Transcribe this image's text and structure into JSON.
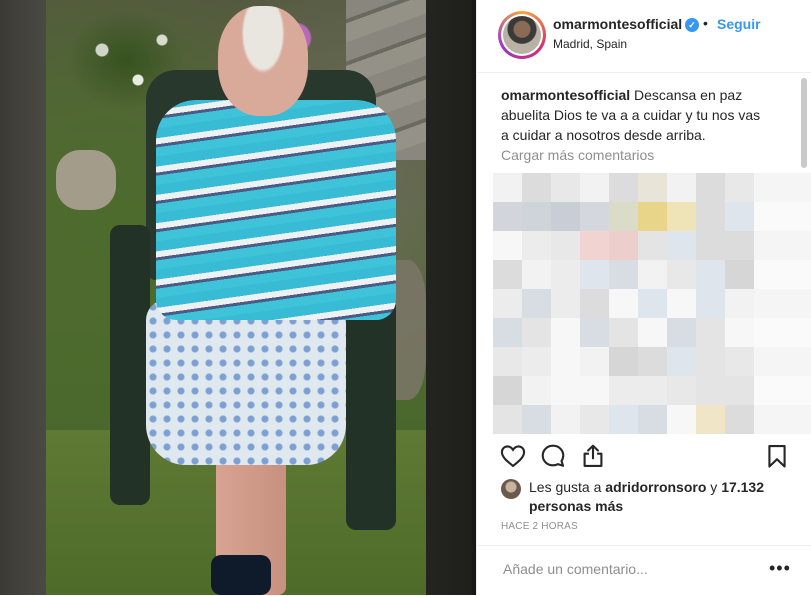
{
  "post": {
    "username": "omarmontesofficial",
    "verified_mark": "✓",
    "separator": "•",
    "follow_label": "Seguir",
    "location": "Madrid, Spain"
  },
  "caption": {
    "author": "omarmontesofficial",
    "text": "Descansa en paz abuelita Dios te va a a cuidar y tu nos vas a cuidar a nosotros desde arriba."
  },
  "load_more_comments": "Cargar más comentarios",
  "actions": {
    "like_icon": "heart-icon",
    "comment_icon": "comment-icon",
    "share_icon": "share-icon",
    "save_icon": "bookmark-icon"
  },
  "likes": {
    "prefix": "Les gusta a",
    "user": "adridorronsoro",
    "conjunction": "y",
    "others": "17.132 personas más"
  },
  "timestamp": "HACE 2 HORAS",
  "add_comment": {
    "placeholder": "Añade un comentario...",
    "more_label": "•••"
  },
  "colors": {
    "accent": "#3897f0",
    "text": "#262626",
    "muted": "#8e8e8e",
    "divider": "#efefef"
  }
}
